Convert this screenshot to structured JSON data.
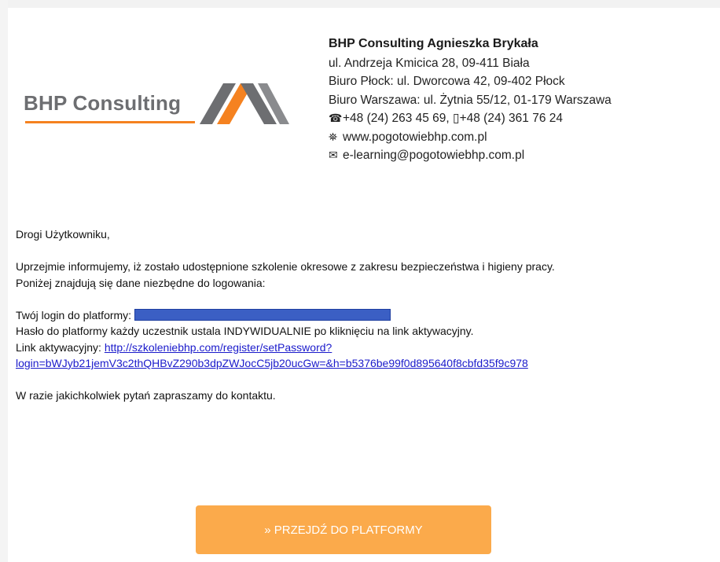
{
  "header": {
    "logo": {
      "text": "BHP Consulting",
      "accent_color": "#f58220",
      "text_color": "#6d6e71"
    },
    "contact": {
      "company": "BHP Consulting Agnieszka Brykała",
      "address": "ul. Andrzeja Kmicica 28, 09-411 Biała",
      "office_plock": "Biuro Płock: ul. Dworcowa 42, 09-402 Płock",
      "office_warsaw": "Biuro Warszawa: ul. Żytnia 55/12, 01-179 Warszawa",
      "phone_icon": "☎",
      "phone": "+48 (24) 263 45 69,",
      "fax_icon": "▯",
      "fax": "+48 (24) 361 76 24",
      "web_icon": "⛯",
      "website": "www.pogotowiebhp.com.pl",
      "mail_icon": "✉",
      "email": "e-learning@pogotowiebhp.com.pl"
    }
  },
  "message": {
    "greeting": "Drogi Użytkowniku,",
    "intro_line1": "Uprzejmie informujemy, iż zostało udostępnione szkolenie okresowe z zakresu bezpieczeństwa i higieny pracy.",
    "intro_line2": "Poniżej znajdują się dane niezbędne do logowania:",
    "login_label": "Twój login do platformy:",
    "password_info": "Hasło do platformy każdy uczestnik ustala INDYWIDUALNIE po kliknięciu na link aktywacyjny.",
    "activation_label": "Link aktywacyjny:",
    "activation_link_line1": "http://szkoleniebhp.com/register/setPassword?",
    "activation_link_line2": "login=bWJyb21jemV3c2thQHBvZ290b3dpZWJocC5jb20ucGw=&h=b5376be99f0d895640f8cbfd35f9c978",
    "closing": "W razie jakichkolwiek pytań zapraszamy do kontaktu."
  },
  "cta": {
    "label": "» PRZEJDŹ DO PLATFORMY",
    "color": "#fbaa4b"
  },
  "redaction_color": "#3b5fc4"
}
